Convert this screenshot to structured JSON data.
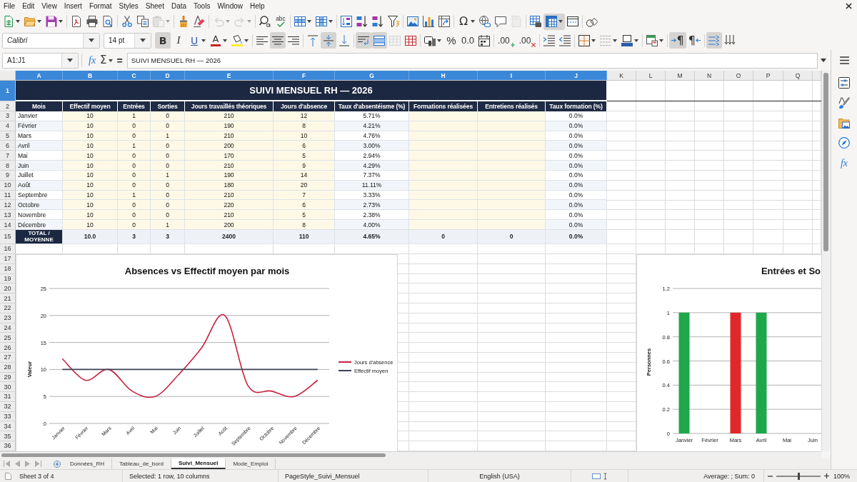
{
  "menu_bar": [
    "File",
    "Edit",
    "View",
    "Insert",
    "Format",
    "Styles",
    "Sheet",
    "Data",
    "Tools",
    "Window",
    "Help"
  ],
  "standard_toolbar": {
    "paste": {
      "disabled": true
    },
    "undo": {
      "disabled": true
    },
    "redo": {
      "disabled": true
    },
    "spelling": {
      "glyph": "abc"
    },
    "special_character": {
      "glyph": "Ω"
    },
    "header_footer": {
      "disabled": true
    },
    "freeze_rows_columns": {
      "on": true
    }
  },
  "formatting_toolbar": {
    "font_name": "Calibri",
    "font_size": "14 pt",
    "bold": {
      "glyph": "B",
      "on": true
    },
    "italic": {
      "glyph": "I",
      "on": false
    },
    "underline": {
      "glyph": "U",
      "on": false
    },
    "font_color": {
      "glyph": "A"
    },
    "align_left": {
      "on": false
    },
    "align_center": {
      "on": true
    },
    "align_right": {
      "on": false
    },
    "align_top": {
      "on": false
    },
    "align_middle": {
      "on": true
    },
    "align_bottom": {
      "on": false
    },
    "wrap_text": {
      "on": true
    },
    "merge_and_center": {
      "on": true
    },
    "merge_cells": {
      "disabled": true
    },
    "percent": {
      "glyph": "%"
    },
    "number": {
      "glyph": "0.0"
    },
    "add_decimal": {
      "glyph": ".00"
    },
    "delete_decimal": {
      "glyph": ".00"
    },
    "left_to_right": {
      "glyph": "¶",
      "on": true
    },
    "right_to_left": {
      "glyph": "¶",
      "on": false
    },
    "text_left_to_right": {
      "on": true
    },
    "text_top_to_bottom": {
      "on": false
    }
  },
  "formula_bar": {
    "name_box": "A1:J1",
    "function_wizard": "fx",
    "sum": "Σ",
    "equals": "=",
    "content": "SUIVI MENSUEL RH — 2026"
  },
  "sheet": {
    "columns": [
      {
        "label": "A",
        "selected": true
      },
      {
        "label": "B",
        "selected": true
      },
      {
        "label": "C",
        "selected": true
      },
      {
        "label": "D",
        "selected": true
      },
      {
        "label": "E",
        "selected": true
      },
      {
        "label": "F",
        "selected": true
      },
      {
        "label": "G",
        "selected": true
      },
      {
        "label": "H",
        "selected": true
      },
      {
        "label": "I",
        "selected": true
      },
      {
        "label": "J",
        "selected": true
      },
      {
        "label": "K",
        "selected": false
      },
      {
        "label": "L",
        "selected": false
      },
      {
        "label": "M",
        "selected": false
      },
      {
        "label": "N",
        "selected": false
      },
      {
        "label": "O",
        "selected": false
      },
      {
        "label": "P",
        "selected": false
      },
      {
        "label": "Q",
        "selected": false
      }
    ],
    "row_headers": [
      {
        "label": "1",
        "selected": true
      },
      {
        "label": "2",
        "selected": false
      },
      {
        "label": "3",
        "selected": false
      },
      {
        "label": "4",
        "selected": false
      },
      {
        "label": "5",
        "selected": false
      },
      {
        "label": "6",
        "selected": false
      },
      {
        "label": "7",
        "selected": false
      },
      {
        "label": "8",
        "selected": false
      },
      {
        "label": "9",
        "selected": false
      },
      {
        "label": "10",
        "selected": false
      },
      {
        "label": "11",
        "selected": false
      },
      {
        "label": "12",
        "selected": false
      },
      {
        "label": "13",
        "selected": false
      },
      {
        "label": "14",
        "selected": false
      },
      {
        "label": "15",
        "selected": false
      },
      {
        "label": "16",
        "selected": false
      },
      {
        "label": "17",
        "selected": false
      },
      {
        "label": "18",
        "selected": false
      },
      {
        "label": "19",
        "selected": false
      },
      {
        "label": "20",
        "selected": false
      },
      {
        "label": "21",
        "selected": false
      },
      {
        "label": "22",
        "selected": false
      },
      {
        "label": "23",
        "selected": false
      },
      {
        "label": "24",
        "selected": false
      },
      {
        "label": "25",
        "selected": false
      },
      {
        "label": "26",
        "selected": false
      },
      {
        "label": "27",
        "selected": false
      },
      {
        "label": "28",
        "selected": false
      },
      {
        "label": "29",
        "selected": false
      },
      {
        "label": "30",
        "selected": false
      },
      {
        "label": "31",
        "selected": false
      },
      {
        "label": "32",
        "selected": false
      },
      {
        "label": "33",
        "selected": false
      },
      {
        "label": "34",
        "selected": false
      },
      {
        "label": "35",
        "selected": false
      },
      {
        "label": "36",
        "selected": false
      }
    ],
    "title": "SUIVI MENSUEL RH — 2026",
    "headers": [
      "Mois",
      "Effectif moyen",
      "Entrées",
      "Sorties",
      "Jours travaillés théoriques",
      "Jours d'absence",
      "Taux d'absentéisme (%)",
      "Formations réalisées",
      "Entretiens réalisés",
      "Taux formation (%)"
    ],
    "rows": [
      {
        "mois": "Janvier",
        "effectif_moyen": "10",
        "entrees": "1",
        "sorties": "0",
        "jours_travailles": "210",
        "jours_absence": "12",
        "taux_absenteisme": "5.71%",
        "taux_formation": "0.0%"
      },
      {
        "mois": "Février",
        "effectif_moyen": "10",
        "entrees": "0",
        "sorties": "0",
        "jours_travailles": "190",
        "jours_absence": "8",
        "taux_absenteisme": "4.21%",
        "taux_formation": "0.0%"
      },
      {
        "mois": "Mars",
        "effectif_moyen": "10",
        "entrees": "0",
        "sorties": "1",
        "jours_travailles": "210",
        "jours_absence": "10",
        "taux_absenteisme": "4.76%",
        "taux_formation": "0.0%"
      },
      {
        "mois": "Avril",
        "effectif_moyen": "10",
        "entrees": "1",
        "sorties": "0",
        "jours_travailles": "200",
        "jours_absence": "6",
        "taux_absenteisme": "3.00%",
        "taux_formation": "0.0%"
      },
      {
        "mois": "Mai",
        "effectif_moyen": "10",
        "entrees": "0",
        "sorties": "0",
        "jours_travailles": "170",
        "jours_absence": "5",
        "taux_absenteisme": "2.94%",
        "taux_formation": "0.0%"
      },
      {
        "mois": "Juin",
        "effectif_moyen": "10",
        "entrees": "0",
        "sorties": "0",
        "jours_travailles": "210",
        "jours_absence": "9",
        "taux_absenteisme": "4.29%",
        "taux_formation": "0.0%"
      },
      {
        "mois": "Juillet",
        "effectif_moyen": "10",
        "entrees": "0",
        "sorties": "1",
        "jours_travailles": "190",
        "jours_absence": "14",
        "taux_absenteisme": "7.37%",
        "taux_formation": "0.0%"
      },
      {
        "mois": "Août",
        "effectif_moyen": "10",
        "entrees": "0",
        "sorties": "0",
        "jours_travailles": "180",
        "jours_absence": "20",
        "taux_absenteisme": "11.11%",
        "taux_formation": "0.0%"
      },
      {
        "mois": "Septembre",
        "effectif_moyen": "10",
        "entrees": "1",
        "sorties": "0",
        "jours_travailles": "210",
        "jours_absence": "7",
        "taux_absenteisme": "3.33%",
        "taux_formation": "0.0%"
      },
      {
        "mois": "Octobre",
        "effectif_moyen": "10",
        "entrees": "0",
        "sorties": "0",
        "jours_travailles": "220",
        "jours_absence": "6",
        "taux_absenteisme": "2.73%",
        "taux_formation": "0.0%"
      },
      {
        "mois": "Novembre",
        "effectif_moyen": "10",
        "entrees": "0",
        "sorties": "0",
        "jours_travailles": "210",
        "jours_absence": "5",
        "taux_absenteisme": "2.38%",
        "taux_formation": "0.0%"
      },
      {
        "mois": "Décembre",
        "effectif_moyen": "10",
        "entrees": "0",
        "sorties": "1",
        "jours_travailles": "200",
        "jours_absence": "8",
        "taux_absenteisme": "4.00%",
        "taux_formation": "0.0%"
      }
    ],
    "total_row": {
      "mois": "TOTAL / MOYENNE",
      "effectif_moyen": "10.0",
      "entrees": "3",
      "sorties": "3",
      "jours_travailles": "2400",
      "jours_absence": "110",
      "taux_absenteisme": "4.65%",
      "formations": "0",
      "entretiens": "0",
      "taux_formation": "0.0%"
    },
    "charts": [
      {
        "chart_data": {
          "type": "line",
          "title": "Absences vs Effectif moyen par mois",
          "ylabel": "Valeur",
          "categories": [
            "Janvier",
            "Février",
            "Mars",
            "Avril",
            "Mai",
            "Juin",
            "Juillet",
            "Août",
            "Septembre",
            "Octobre",
            "Novembre",
            "Décembre"
          ],
          "series": [
            {
              "name": "Jours d'absence",
              "color": "#c9213f",
              "values": [
                12,
                8,
                10,
                6,
                5,
                9,
                14,
                20,
                7,
                6,
                5,
                8
              ]
            },
            {
              "name": "Effectif moyen",
              "color": "#3a4356",
              "values": [
                10,
                10,
                10,
                10,
                10,
                10,
                10,
                10,
                10,
                10,
                10,
                10
              ]
            }
          ],
          "ylim": [
            0,
            25
          ],
          "yticks": [
            0,
            5,
            10,
            15,
            20,
            25
          ],
          "grid": true,
          "legend": "right"
        }
      },
      {
        "chart_data": {
          "type": "bar",
          "title": "Entrées et So",
          "ylabel": "Personnes",
          "categories": [
            "Janvier",
            "Février",
            "Mars",
            "Avril",
            "Mai",
            "Juin"
          ],
          "series": [
            {
              "color": "#1ea84b",
              "values": [
                1,
                0,
                0,
                1,
                0,
                0
              ]
            },
            {
              "color": "#e0282a",
              "values": [
                0,
                0,
                1,
                0,
                0,
                0
              ]
            }
          ],
          "ylim": [
            0,
            1.2
          ],
          "yticks": [
            0,
            0.2,
            0.4,
            0.6,
            0.8,
            1,
            1.2
          ],
          "stacked": true,
          "grid": true
        }
      }
    ]
  },
  "sheet_tabs": [
    {
      "label": "Données_RH",
      "selected": false
    },
    {
      "label": "Tableau_de_bord",
      "selected": false
    },
    {
      "label": "Suivi_Mensuel",
      "selected": true
    },
    {
      "label": "Mode_Emploi",
      "selected": false
    }
  ],
  "sidebar": {
    "functions": {
      "glyph": "fx"
    }
  },
  "status_bar": {
    "sheet": "Sheet 3 of 4",
    "selection": "Selected: 1 row, 10 columns",
    "page_style": "PageStyle_Suivi_Mensuel",
    "language": "English (USA)",
    "summary": "Average: ; Sum: 0",
    "zoom_slider": {
      "level": 0.5
    },
    "zoom": "100%"
  }
}
